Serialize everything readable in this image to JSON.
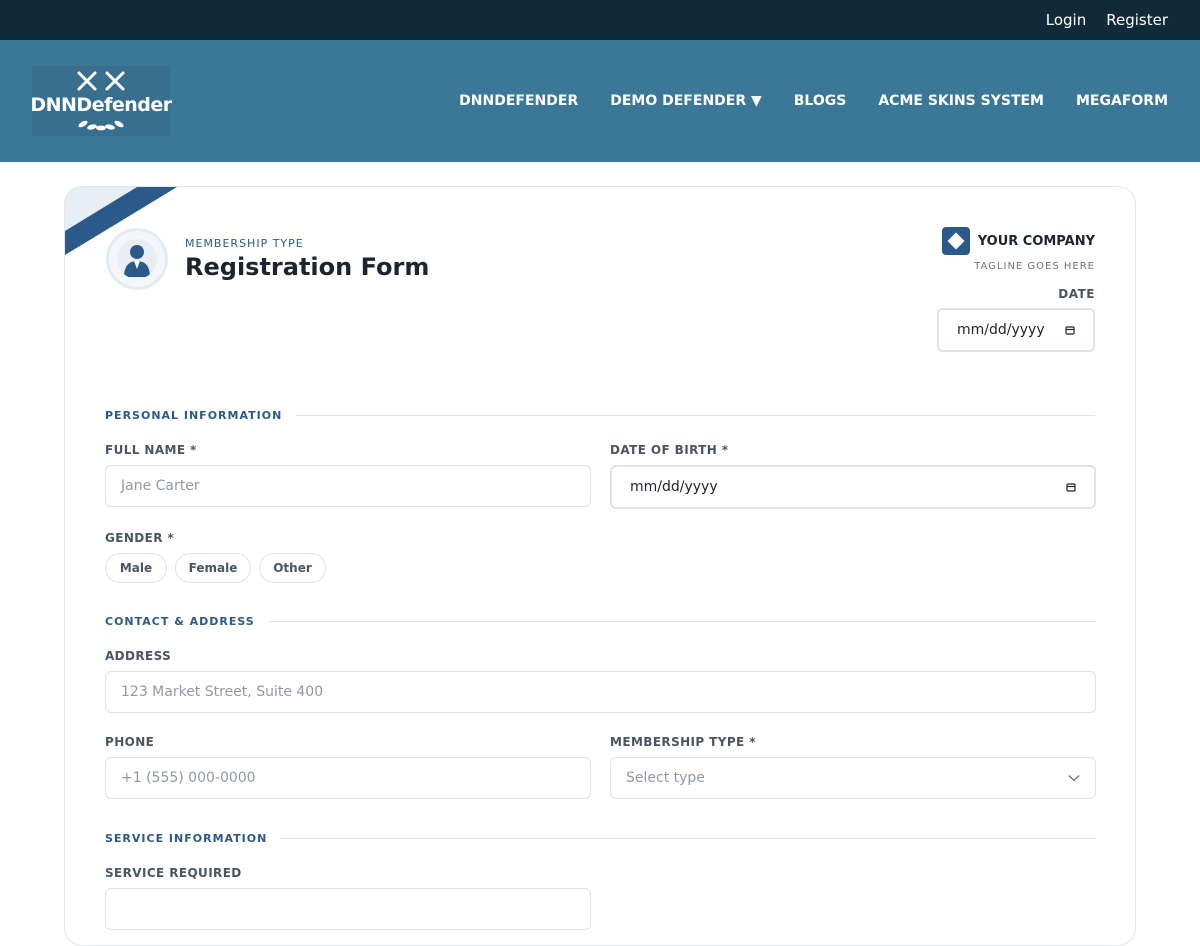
{
  "topbar": {
    "login": "Login",
    "register": "Register"
  },
  "logo": {
    "text": "DNNDefender"
  },
  "nav": [
    {
      "label": "DNNDEFENDER"
    },
    {
      "label": "DEMO DEFENDER ▼"
    },
    {
      "label": "BLOGS"
    },
    {
      "label": "ACME SKINS SYSTEM"
    },
    {
      "label": "MEGAFORM"
    }
  ],
  "form": {
    "kicker": "MEMBERSHIP TYPE",
    "title": "Registration Form",
    "company": "YOUR COMPANY",
    "tagline": "TAGLINE GOES HERE",
    "date_label": "DATE",
    "date_placeholder": "mm/dd/yyyy"
  },
  "sections": {
    "personal": "PERSONAL INFORMATION",
    "contact": "CONTACT & ADDRESS",
    "service": "SERVICE INFORMATION"
  },
  "fields": {
    "full_name_label": "FULL NAME *",
    "full_name_placeholder": "Jane Carter",
    "dob_label": "DATE OF BIRTH *",
    "dob_placeholder": "mm/dd/yyyy",
    "gender_label": "GENDER *",
    "gender_options": [
      "Male",
      "Female",
      "Other"
    ],
    "address_label": "ADDRESS",
    "address_placeholder": "123 Market Street, Suite 400",
    "phone_label": "PHONE",
    "phone_placeholder": "+1 (555) 000-0000",
    "membership_label": "MEMBERSHIP TYPE *",
    "membership_placeholder": "Select type",
    "service_label": "SERVICE REQUIRED"
  },
  "colors": {
    "topbar": "#102a3a",
    "header": "#3b7797",
    "accent": "#2b5a8a"
  },
  "icons": {
    "calendar": "calendar-icon",
    "chevron": "chevron-down-icon",
    "avatar": "user-icon"
  }
}
